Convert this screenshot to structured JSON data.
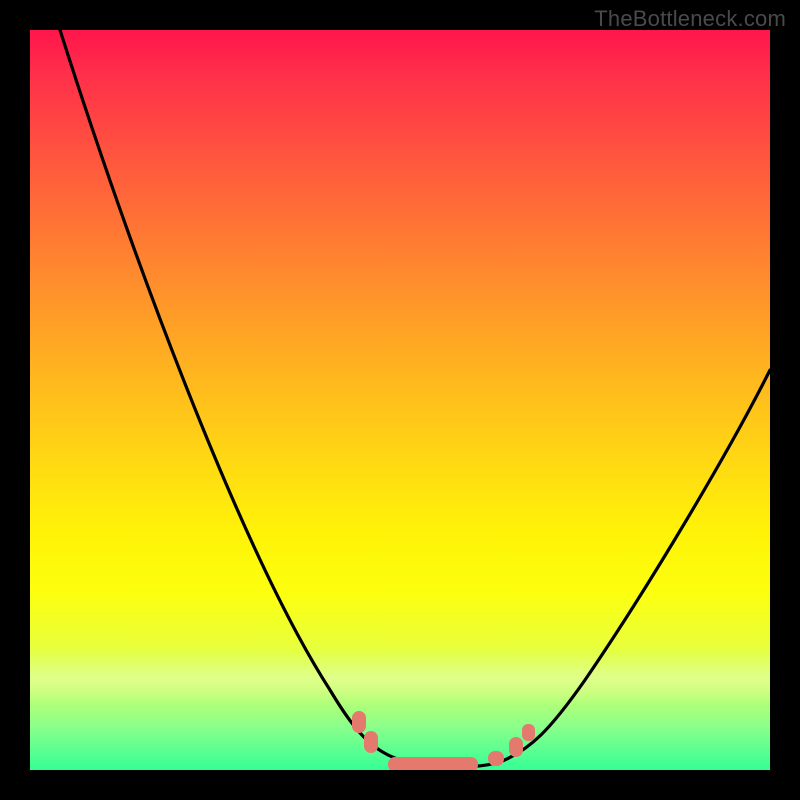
{
  "watermark": "TheBottleneck.com",
  "colors": {
    "frame_bg": "#000000",
    "curve_stroke": "#000000",
    "marker_fill": "#e47a6d",
    "gradient_stops": [
      "#ff164b",
      "#ff2f4a",
      "#ff5f3b",
      "#ff8a2e",
      "#ffb41f",
      "#ffd813",
      "#fff308",
      "#fcff0e",
      "#eaff3a",
      "#c6ff6a",
      "#8dff8b",
      "#34ff96"
    ]
  },
  "chart_data": {
    "type": "line",
    "title": "",
    "xlabel": "",
    "ylabel": "",
    "xlim": [
      0,
      100
    ],
    "ylim": [
      0,
      100
    ],
    "grid": false,
    "legend": false,
    "x": [
      4,
      6,
      8,
      10,
      12,
      14,
      16,
      18,
      20,
      22,
      24,
      26,
      28,
      30,
      32,
      34,
      36,
      38,
      40,
      42,
      44,
      46,
      48,
      50,
      52,
      54,
      56,
      58,
      60,
      62,
      64,
      66,
      68,
      70,
      72,
      74,
      76,
      78,
      80,
      82,
      84,
      86,
      88,
      90,
      92,
      94,
      96,
      98,
      100
    ],
    "values": [
      100,
      95,
      90,
      85,
      80,
      75,
      70,
      65,
      60,
      55,
      50,
      45,
      40,
      36,
      32,
      28,
      24,
      20,
      16,
      12,
      9,
      6,
      4,
      2,
      1,
      0,
      0,
      0,
      0,
      1,
      2,
      4,
      6,
      9,
      12,
      16,
      20,
      24,
      27,
      30,
      33,
      36,
      39,
      42,
      45,
      47,
      50,
      52,
      55
    ],
    "annotations": [
      {
        "type": "marker_cluster",
        "x_range": [
          45,
          66
        ],
        "y_range": [
          0,
          5
        ],
        "description": "salmon-colored rounded markers"
      }
    ],
    "description": "Asymmetric V-shaped bottleneck curve over a vertical red→yellow→green gradient background; steep left descent, flat trough with salmon markers, shallower right ascent. Black page border frames the gradient."
  }
}
